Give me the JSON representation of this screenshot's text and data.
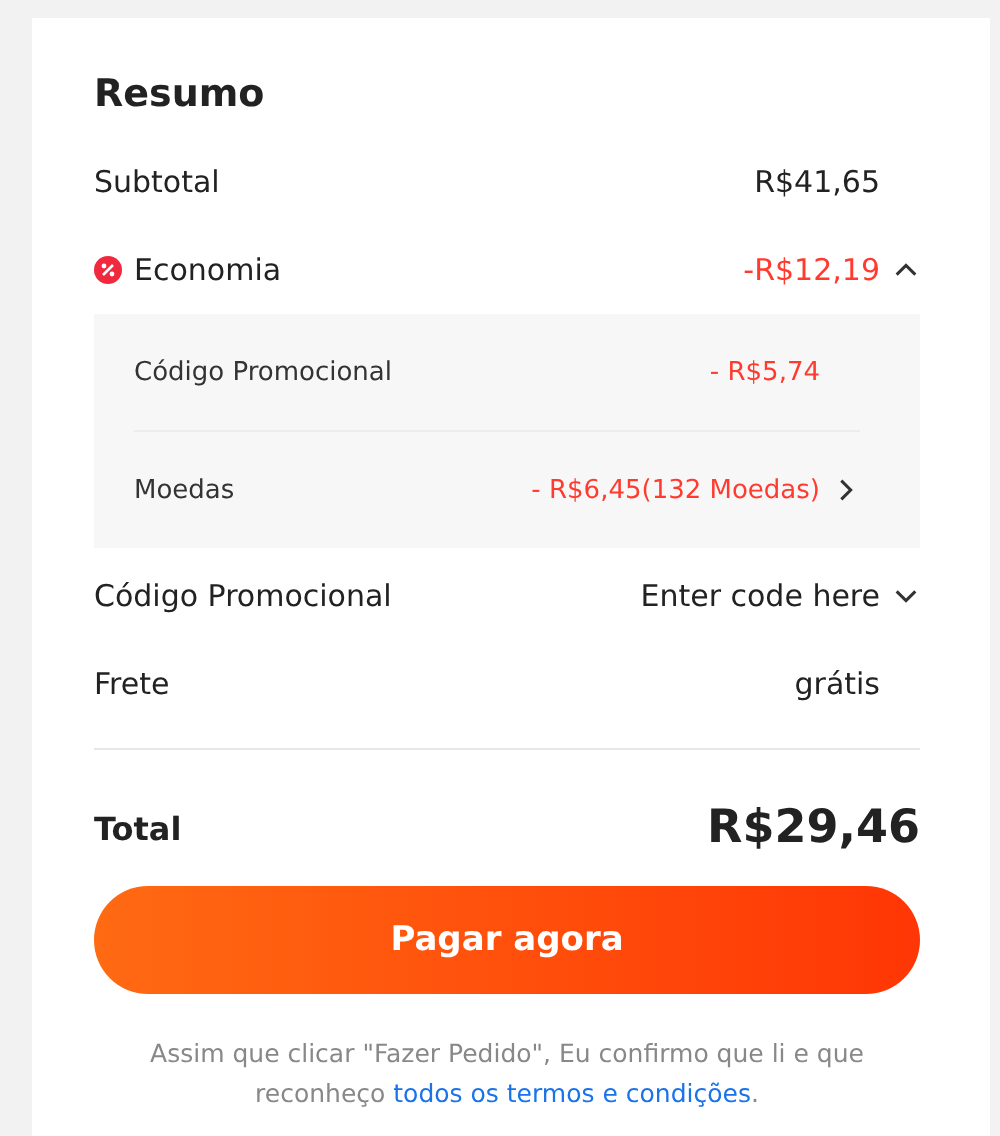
{
  "title": "Resumo",
  "subtotal": {
    "label": "Subtotal",
    "value": "R$41,65"
  },
  "savings": {
    "label": "Economia",
    "value": "-R$12,19",
    "expanded": true,
    "items": [
      {
        "kind": "plain",
        "label": "Código Promocional",
        "value": "- R$5,74"
      },
      {
        "kind": "link",
        "label": "Moedas",
        "value": "- R$6,45(132 Moedas)"
      }
    ]
  },
  "promo": {
    "label": "Código Promocional",
    "placeholder": "Enter code here"
  },
  "shipping": {
    "label": "Frete",
    "value": "grátis"
  },
  "total": {
    "label": "Total",
    "value": "R$29,46"
  },
  "button": "Pagar agora",
  "disclaimer": {
    "text": "Assim que clicar \"Fazer Pedido\", Eu confirmo que li e que reconheço",
    "link": "todos os termos e condições",
    "end": "."
  }
}
